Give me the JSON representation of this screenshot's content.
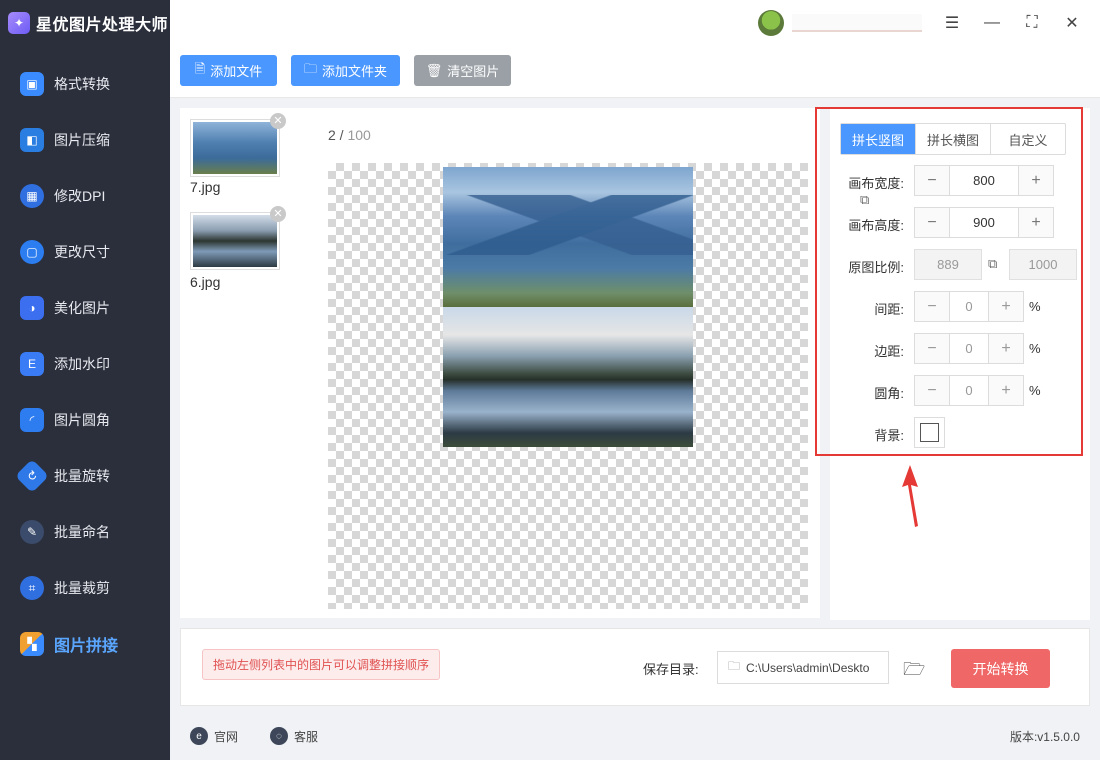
{
  "app": {
    "title": "星优图片处理大师"
  },
  "sidebar": {
    "items": [
      {
        "label": "格式转换",
        "icon": "image-convert-icon",
        "color": "#3a8bff"
      },
      {
        "label": "图片压缩",
        "icon": "image-compress-icon",
        "color": "#2a7de1"
      },
      {
        "label": "修改DPI",
        "icon": "dpi-icon",
        "color": "#2f6fe0"
      },
      {
        "label": "更改尺寸",
        "icon": "resize-icon",
        "color": "#2b7df0"
      },
      {
        "label": "美化图片",
        "icon": "beautify-icon",
        "color": "#3b6ff0"
      },
      {
        "label": "添加水印",
        "icon": "watermark-icon",
        "color": "#3a7cf5"
      },
      {
        "label": "图片圆角",
        "icon": "rounded-corner-icon",
        "color": "#2d7cf0"
      },
      {
        "label": "批量旋转",
        "icon": "rotate-icon",
        "color": "#2f78e8"
      },
      {
        "label": "批量命名",
        "icon": "rename-icon",
        "color": "#3b4b6b"
      },
      {
        "label": "批量裁剪",
        "icon": "crop-icon",
        "color": "#2f6fe0"
      },
      {
        "label": "图片拼接",
        "icon": "stitch-icon",
        "color": "#f0a030",
        "active": true
      }
    ]
  },
  "toolbar": {
    "add_file": "添加文件",
    "add_folder": "添加文件夹",
    "clear": "清空图片"
  },
  "files": [
    {
      "name": "7.jpg"
    },
    {
      "name": "6.jpg"
    }
  ],
  "preview": {
    "current": "2",
    "separator": " / ",
    "total": "100"
  },
  "settings": {
    "tabs": [
      "拼长竖图",
      "拼长横图",
      "自定义"
    ],
    "active_tab": "拼长竖图",
    "canvas_width_label": "画布宽度:",
    "canvas_width": "800",
    "canvas_height_label": "画布高度:",
    "canvas_height": "900",
    "ratio_label": "原图比例:",
    "ratio_w": "889",
    "ratio_h": "1000",
    "spacing_label": "间距:",
    "spacing": "0",
    "margin_label": "边距:",
    "margin": "0",
    "radius_label": "圆角:",
    "radius": "0",
    "percent": "%",
    "background_label": "背景:",
    "background_color": "#ffffff"
  },
  "bottom": {
    "hint": "拖动左侧列表中的图片可以调整拼接顺序",
    "save_label": "保存目录:",
    "save_path": "C:\\Users\\admin\\Deskto",
    "start": "开始转换"
  },
  "footer": {
    "website": "官网",
    "service": "客服",
    "version": "版本:v1.5.0.0"
  },
  "colors": {
    "accent": "#4a97ff",
    "danger": "#f06767",
    "highlight": "#e53935"
  }
}
